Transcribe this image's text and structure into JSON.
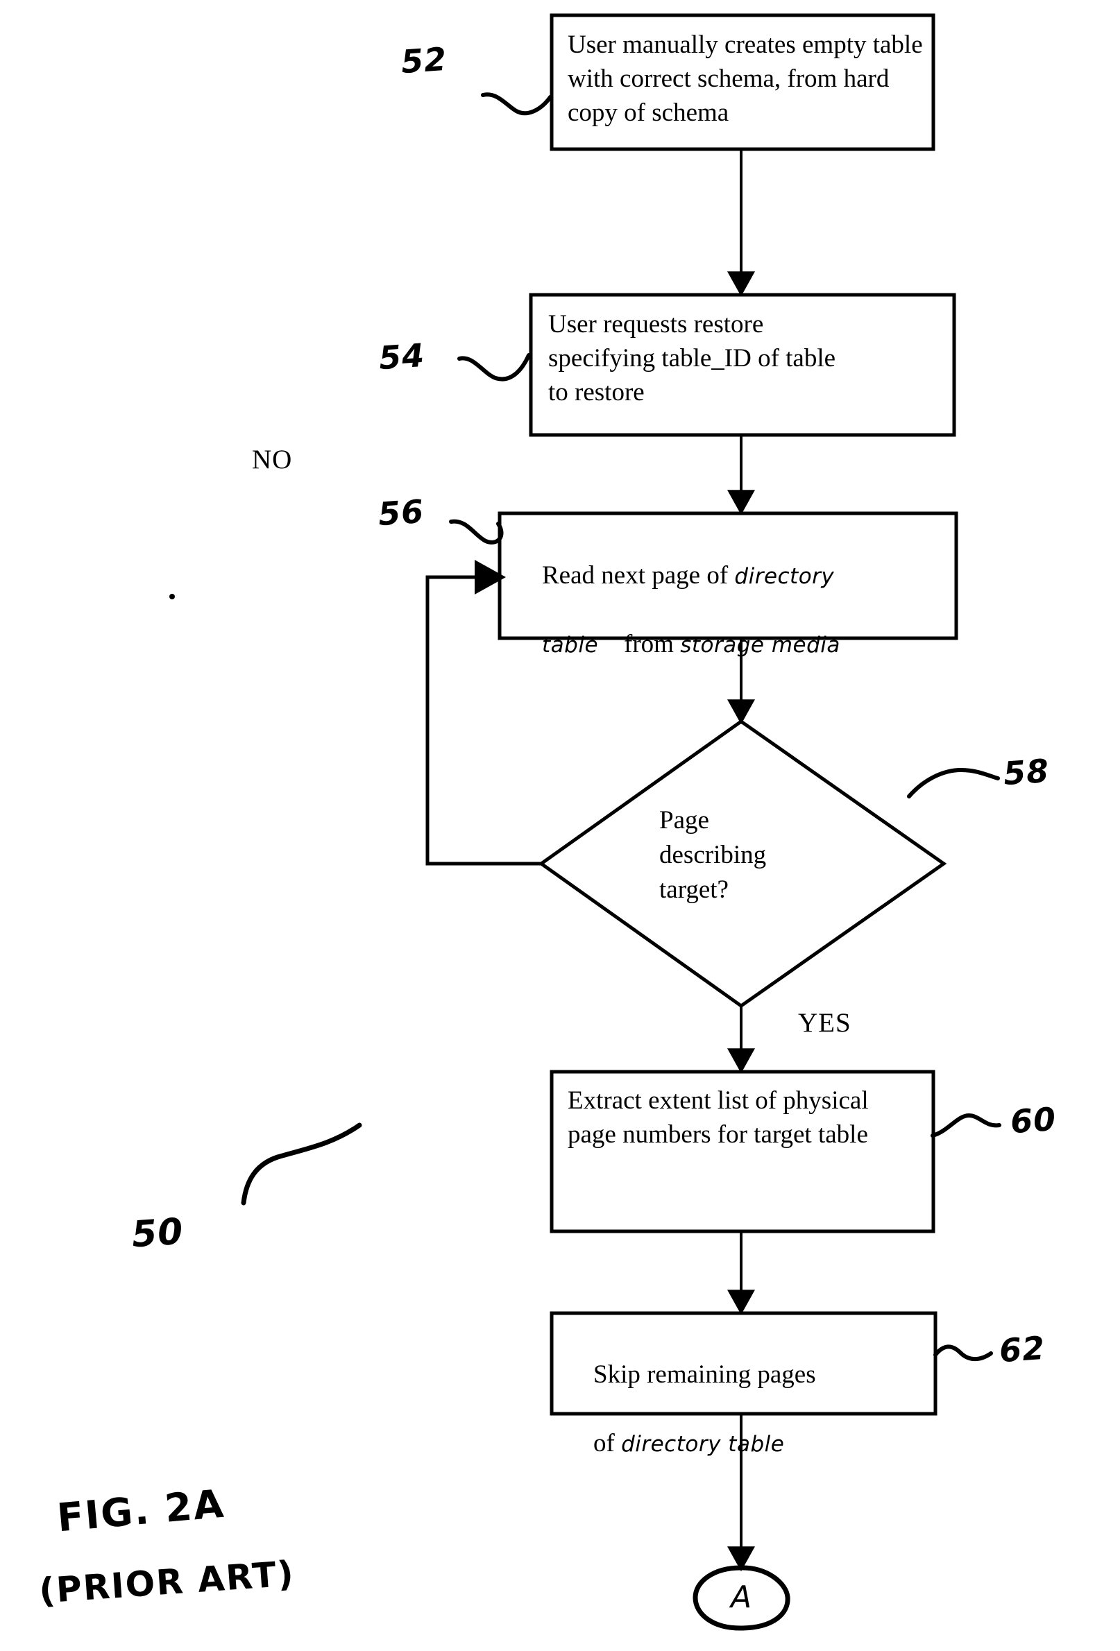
{
  "figure": {
    "caption_line1": "FIG. 2A",
    "caption_line2": "(PRIOR ART)",
    "diagram_ref": "50"
  },
  "nodes": [
    {
      "id": "step-52",
      "ref": "52",
      "kind": "process",
      "text": "User manually creates empty table with correct schema, from hard copy of schema"
    },
    {
      "id": "step-54",
      "ref": "54",
      "kind": "process",
      "text": "User requests restore specifying table_ID of table to restore"
    },
    {
      "id": "step-56",
      "ref": "56",
      "kind": "process",
      "text_part1": "Read next page of ",
      "handwritten1": "directory",
      "text_part2": "",
      "handwritten2": "table",
      "text_part3": "from ",
      "handwritten3": "storage media"
    },
    {
      "id": "decision-58",
      "ref": "58",
      "kind": "decision",
      "line1": "Page",
      "line2": "describing",
      "line3": "target?"
    },
    {
      "id": "step-60",
      "ref": "60",
      "kind": "process",
      "text": "Extract extent list of physical page numbers for target table"
    },
    {
      "id": "step-62",
      "ref": "62",
      "kind": "process",
      "text_part1": "Skip remaining pages",
      "text_part2": "of ",
      "handwritten1": "directory table"
    },
    {
      "id": "connector-a",
      "kind": "connector",
      "label": "A"
    }
  ],
  "branches": {
    "no_label": "NO",
    "yes_label": "YES"
  },
  "colors": {
    "ink": "#000000",
    "paper": "#ffffff"
  }
}
